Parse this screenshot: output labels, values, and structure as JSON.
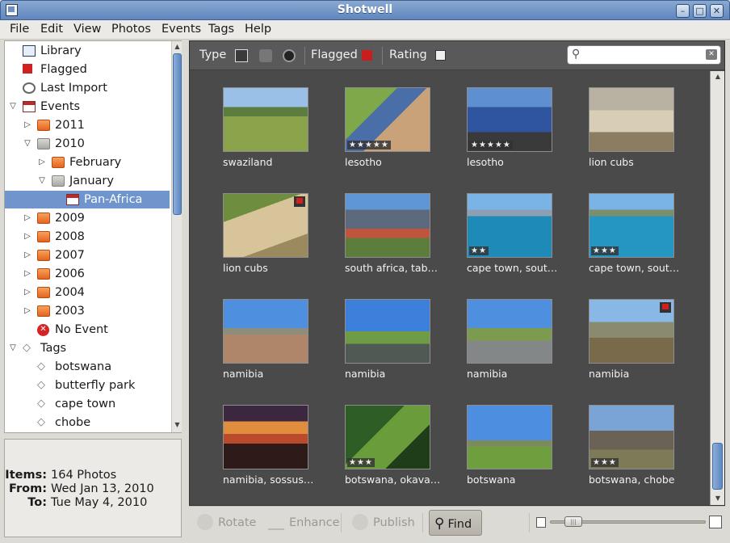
{
  "window": {
    "title": "Shotwell"
  },
  "menu": [
    "File",
    "Edit",
    "View",
    "Photos",
    "Events",
    "Tags",
    "Help"
  ],
  "sidebar": {
    "items": [
      {
        "label": "Library",
        "icon": "library-icon",
        "expander": "",
        "indent": 0
      },
      {
        "label": "Flagged",
        "icon": "flag-icon",
        "expander": "",
        "indent": 0
      },
      {
        "label": "Last Import",
        "icon": "clock-icon",
        "expander": "",
        "indent": 0
      },
      {
        "label": "Events",
        "icon": "events-icon",
        "expander": "open",
        "indent": 0
      },
      {
        "label": "2011",
        "icon": "folder-icon",
        "expander": "closed",
        "indent": 1
      },
      {
        "label": "2010",
        "icon": "folder-grey-icon",
        "expander": "open",
        "indent": 1
      },
      {
        "label": "February",
        "icon": "folder-icon",
        "expander": "closed",
        "indent": 2
      },
      {
        "label": "January",
        "icon": "folder-grey-icon",
        "expander": "open",
        "indent": 2
      },
      {
        "label": "Pan-Africa",
        "icon": "event-icon",
        "expander": "",
        "indent": 3,
        "selected": true
      },
      {
        "label": "2009",
        "icon": "folder-icon",
        "expander": "closed",
        "indent": 1
      },
      {
        "label": "2008",
        "icon": "folder-icon",
        "expander": "closed",
        "indent": 1
      },
      {
        "label": "2007",
        "icon": "folder-icon",
        "expander": "closed",
        "indent": 1
      },
      {
        "label": "2006",
        "icon": "folder-icon",
        "expander": "closed",
        "indent": 1
      },
      {
        "label": "2004",
        "icon": "folder-icon",
        "expander": "closed",
        "indent": 1
      },
      {
        "label": "2003",
        "icon": "folder-icon",
        "expander": "closed",
        "indent": 1
      },
      {
        "label": "No Event",
        "icon": "no-event-icon",
        "expander": "",
        "indent": 1
      },
      {
        "label": "Tags",
        "icon": "tags-icon",
        "expander": "open",
        "indent": 0
      },
      {
        "label": "botswana",
        "icon": "tag-icon",
        "expander": "",
        "indent": 1
      },
      {
        "label": "butterfly park",
        "icon": "tag-icon",
        "expander": "",
        "indent": 1
      },
      {
        "label": "cape town",
        "icon": "tag-icon",
        "expander": "",
        "indent": 1
      },
      {
        "label": "chobe",
        "icon": "tag-icon",
        "expander": "",
        "indent": 1
      }
    ]
  },
  "info": {
    "items_label": "Items:",
    "items_value": "164 Photos",
    "from_label": "From:",
    "from_value": "Wed Jan 13, 2010",
    "to_label": "To:",
    "to_value": "Tue May 4, 2010"
  },
  "filterbar": {
    "type_label": "Type",
    "flagged_label": "Flagged",
    "rating_label": "Rating",
    "search_value": "",
    "search_placeholder": ""
  },
  "photos": [
    {
      "caption": "swaziland",
      "stars": 0,
      "flagged": false,
      "scene": "savanna"
    },
    {
      "caption": "lesotho",
      "stars": 5,
      "flagged": false,
      "scene": "kids"
    },
    {
      "caption": "lesotho",
      "stars": 5,
      "flagged": false,
      "scene": "crowd"
    },
    {
      "caption": "lion cubs",
      "stars": 0,
      "flagged": false,
      "scene": "lions"
    },
    {
      "caption": "lion cubs",
      "stars": 0,
      "flagged": true,
      "scene": "lion-close"
    },
    {
      "caption": "south africa, tab…",
      "stars": 0,
      "flagged": false,
      "scene": "table-mountain"
    },
    {
      "caption": "cape town, sout…",
      "stars": 2,
      "flagged": false,
      "scene": "pool-jump"
    },
    {
      "caption": "cape town, sout…",
      "stars": 3,
      "flagged": false,
      "scene": "pool-jump2"
    },
    {
      "caption": "namibia",
      "stars": 0,
      "flagged": false,
      "scene": "plain"
    },
    {
      "caption": "namibia",
      "stars": 0,
      "flagged": false,
      "scene": "road"
    },
    {
      "caption": "namibia",
      "stars": 0,
      "flagged": false,
      "scene": "road2"
    },
    {
      "caption": "namibia",
      "stars": 0,
      "flagged": true,
      "scene": "hills"
    },
    {
      "caption": "namibia, sossus…",
      "stars": 0,
      "flagged": false,
      "scene": "sunset"
    },
    {
      "caption": "botswana, okava…",
      "stars": 3,
      "flagged": false,
      "scene": "lilies"
    },
    {
      "caption": "botswana",
      "stars": 0,
      "flagged": false,
      "scene": "field"
    },
    {
      "caption": "botswana, chobe",
      "stars": 3,
      "flagged": false,
      "scene": "elephant"
    }
  ],
  "toolbar": {
    "rotate_label": "Rotate",
    "enhance_label": "Enhance",
    "publish_label": "Publish",
    "find_label": "Find",
    "zoom_level": 0.1
  },
  "colors": {
    "selection": "#6f95cc",
    "titlebar": "#6f93c7",
    "grid_bg": "#4a4a4a"
  }
}
